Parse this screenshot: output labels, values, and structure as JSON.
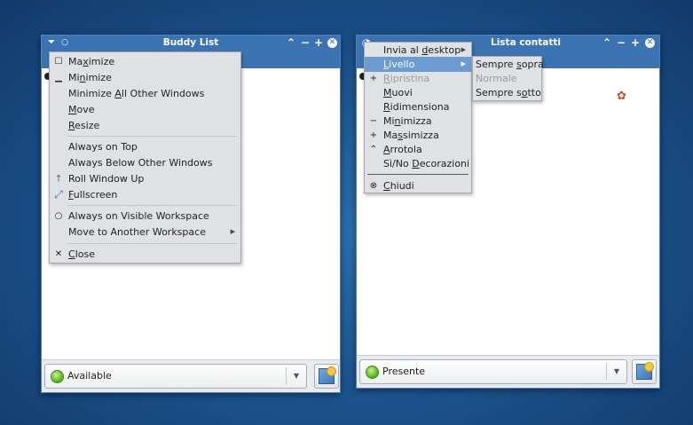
{
  "left_window": {
    "title": "Buddy List",
    "status": "Available",
    "menu": [
      {
        "label": "Maximize",
        "mnemonic_index": 2,
        "icon": "maximize-icon"
      },
      {
        "label": "Minimize",
        "mnemonic_index": 2,
        "icon": "minimize-icon"
      },
      {
        "label": "Minimize All Other Windows",
        "mnemonic_index": 9,
        "icon": ""
      },
      {
        "label": "Move",
        "mnemonic_index": 0,
        "icon": ""
      },
      {
        "label": "Resize",
        "mnemonic_index": 0,
        "icon": ""
      },
      {
        "label": "Always on Top",
        "mnemonic_index": -1,
        "icon": ""
      },
      {
        "label": "Always Below Other Windows",
        "mnemonic_index": -1,
        "icon": ""
      },
      {
        "label": "Roll Window Up",
        "mnemonic_index": -1,
        "icon": "arrow-up-icon"
      },
      {
        "label": "Fullscreen",
        "mnemonic_index": 0,
        "icon": "fullscreen-icon"
      },
      {
        "label": "Always on Visible Workspace",
        "mnemonic_index": -1,
        "icon": "circle-icon"
      },
      {
        "label": "Move to Another Workspace",
        "mnemonic_index": -1,
        "icon": "",
        "submenu": true
      },
      {
        "label": "Close",
        "mnemonic_index": 0,
        "icon": "close-icon"
      }
    ]
  },
  "right_window": {
    "title": "Lista contatti",
    "status": "Presente",
    "menu": [
      {
        "label": "Invia al desktop",
        "mnemonic_index": 9,
        "submenu": true
      },
      {
        "label": "Livello",
        "mnemonic_index": 0,
        "submenu": true,
        "highlighted": true
      },
      {
        "label": "Ripristina",
        "mnemonic_index": 0,
        "disabled": true,
        "icon": "plus-icon"
      },
      {
        "label": "Muovi",
        "mnemonic_index": 0
      },
      {
        "label": "Ridimensiona",
        "mnemonic_index": 0
      },
      {
        "label": "Minimizza",
        "mnemonic_index": 2,
        "icon": "minus-icon"
      },
      {
        "label": "Massimizza",
        "mnemonic_index": 2,
        "icon": "plus-icon"
      },
      {
        "label": "Arrotola",
        "mnemonic_index": 0,
        "icon": "caret-up-icon"
      },
      {
        "label": "Sì/No Decorazioni",
        "mnemonic_index": 6
      },
      {
        "label": "Chiudi",
        "mnemonic_index": 0,
        "icon": "close-circle-icon"
      }
    ],
    "submenu": [
      {
        "label": "Sempre sopra",
        "mnemonic_index": 7
      },
      {
        "label": "Normale",
        "mnemonic_index": -1,
        "disabled": true
      },
      {
        "label": "Sempre sotto",
        "mnemonic_index": 8
      }
    ]
  }
}
